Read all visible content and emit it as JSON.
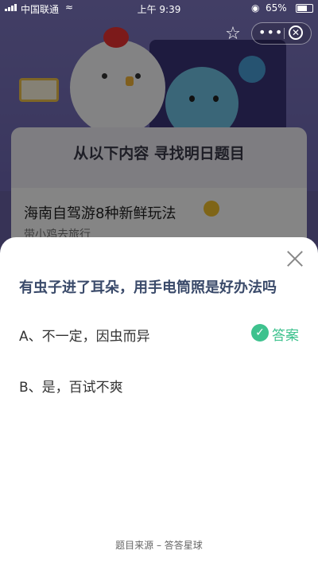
{
  "status_bar": {
    "carrier": "中国联通",
    "time": "上午 9:39",
    "battery": "65%",
    "battery_level": 0.65
  },
  "background": {
    "card_title": "从以下内容 寻找明日题目",
    "article_title": "海南自驾游8种新鲜玩法",
    "article_subtitle": "带小鸡去旅行"
  },
  "capsule": {
    "more_label": "•••"
  },
  "sheet": {
    "question": "有虫子进了耳朵，用手电筒照是好办法吗",
    "options": [
      {
        "label": "A、不一定，因虫而异",
        "is_answer": true
      },
      {
        "label": "B、是，百试不爽",
        "is_answer": false
      }
    ],
    "answer_label": "答案",
    "footer": "题目来源 – 答答星球"
  },
  "colors": {
    "accent_green": "#3ec28e",
    "question_text": "#3a4a6a",
    "background_purple": "#6a63a6"
  }
}
